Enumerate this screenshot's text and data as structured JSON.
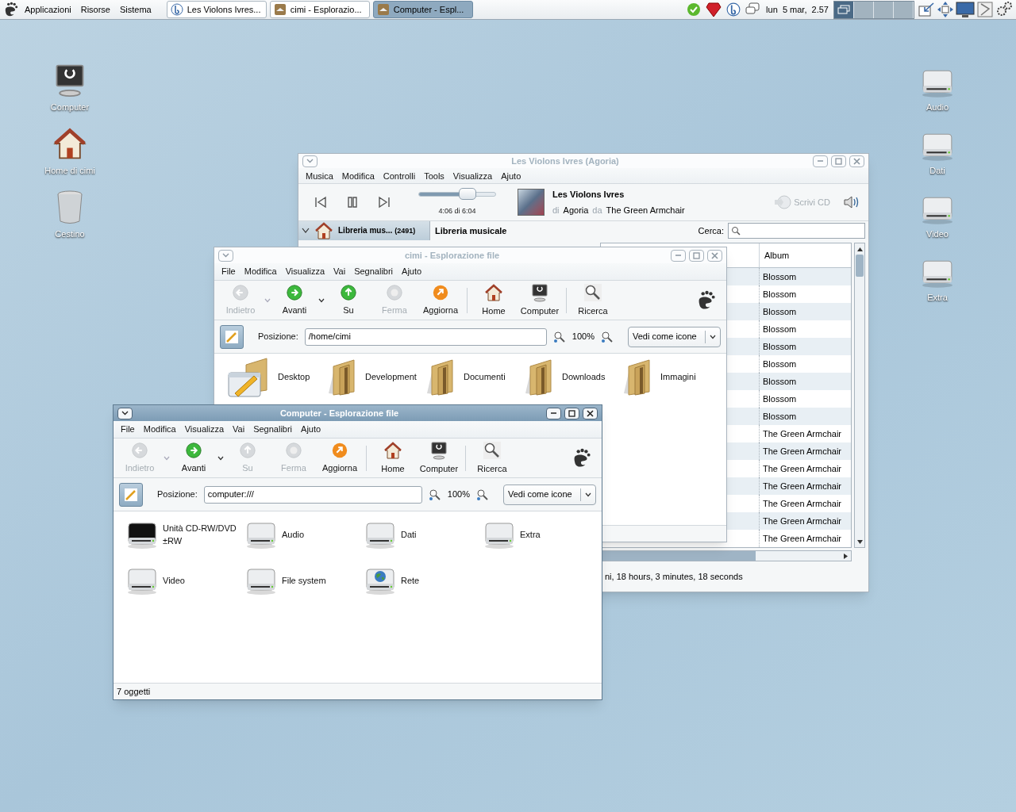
{
  "top_panel": {
    "menus": [
      "Applicazioni",
      "Risorse",
      "Sistema"
    ],
    "tasks": [
      {
        "label": "Les Violons Ivres...",
        "kind": "music",
        "selected": false
      },
      {
        "label": "cimi - Esplorazio...",
        "kind": "folder",
        "selected": false
      },
      {
        "label": "Computer - Espl...",
        "kind": "folder",
        "selected": true
      }
    ],
    "clock": "lun  5 mar,  2.57",
    "workspaces": [
      {
        "selected": true
      },
      {
        "selected": false
      },
      {
        "selected": false
      },
      {
        "selected": false
      }
    ]
  },
  "desktop_icons_left": [
    {
      "label": "Computer",
      "kind": "computer"
    },
    {
      "label": "Home di cimi",
      "kind": "home"
    },
    {
      "label": "Cestino",
      "kind": "trash"
    }
  ],
  "desktop_icons_right": [
    {
      "label": "Audio",
      "kind": "drive"
    },
    {
      "label": "Dati",
      "kind": "drive"
    },
    {
      "label": "Video",
      "kind": "drive"
    },
    {
      "label": "Extra",
      "kind": "drive"
    }
  ],
  "music_window": {
    "title": "Les Violons Ivres (Agoria)",
    "active": false,
    "menu": [
      "Musica",
      "Modifica",
      "Controlli",
      "Tools",
      "Visualizza",
      "Ajuto"
    ],
    "progress": {
      "level": 0.63
    },
    "time": "4:06 di 6:04",
    "track": {
      "title": "Les Violons Ivres",
      "by_label": "di",
      "artist": "Agoria",
      "from_label": "da",
      "album": "The Green Armchair"
    },
    "burn_label": "Scrivi CD",
    "library": {
      "label": "Libreria mus...",
      "count": "(2491)",
      "expanded": true
    },
    "heading": "Libreria musicale",
    "search_label": "Cerca:",
    "column": "Album",
    "rows": [
      "Blossom",
      "Blossom",
      "Blossom",
      "Blossom",
      "Blossom",
      "Blossom",
      "Blossom",
      "Blossom",
      "Blossom",
      "The Green Armchair",
      "The Green Armchair",
      "The Green Armchair",
      "The Green Armchair",
      "The Green Armchair",
      "The Green Armchair",
      "The Green Armchair"
    ],
    "status": "ni, 18 hours, 3 minutes, 18 seconds"
  },
  "file_windows": [
    {
      "title": "cimi - Esplorazione file",
      "active": false,
      "menu": [
        "File",
        "Modifica",
        "Visualizza",
        "Vai",
        "Segnalibri",
        "Ajuto"
      ],
      "toolbar": [
        {
          "label": "Indietro",
          "kind": "back",
          "disabled": true,
          "has_menu": true
        },
        {
          "label": "Avanti",
          "kind": "forward",
          "disabled": false,
          "has_menu": true
        },
        {
          "label": "Su",
          "kind": "up",
          "disabled": false,
          "has_menu": false
        },
        {
          "label": "Ferma",
          "kind": "stop",
          "disabled": true,
          "has_menu": false
        },
        {
          "label": "Aggiorna",
          "kind": "reload",
          "disabled": false,
          "has_menu": false
        },
        {
          "label": "Home",
          "kind": "home",
          "disabled": false,
          "has_menu": false
        },
        {
          "label": "Computer",
          "kind": "computer",
          "disabled": false,
          "has_menu": false
        },
        {
          "label": "Ricerca",
          "kind": "search",
          "disabled": false,
          "has_menu": false
        }
      ],
      "location_label": "Posizione:",
      "location": "/home/cimi",
      "zoom": "100%",
      "view": "Vedi come icone",
      "items": [
        {
          "label": "Desktop",
          "kind": "desktop-folder"
        },
        {
          "label": "Development",
          "kind": "folder"
        },
        {
          "label": "Documenti",
          "kind": "folder"
        },
        {
          "label": "Downloads",
          "kind": "folder"
        },
        {
          "label": "Immagini",
          "kind": "folder"
        }
      ]
    },
    {
      "title": "Computer - Esplorazione file",
      "active": true,
      "menu": [
        "File",
        "Modifica",
        "Visualizza",
        "Vai",
        "Segnalibri",
        "Ajuto"
      ],
      "toolbar": [
        {
          "label": "Indietro",
          "kind": "back",
          "disabled": true,
          "has_menu": true
        },
        {
          "label": "Avanti",
          "kind": "forward",
          "disabled": false,
          "has_menu": true
        },
        {
          "label": "Su",
          "kind": "up",
          "disabled": true,
          "has_menu": false
        },
        {
          "label": "Ferma",
          "kind": "stop",
          "disabled": true,
          "has_menu": false
        },
        {
          "label": "Aggiorna",
          "kind": "reload",
          "disabled": false,
          "has_menu": false
        },
        {
          "label": "Home",
          "kind": "home",
          "disabled": false,
          "has_menu": false
        },
        {
          "label": "Computer",
          "kind": "computer",
          "disabled": false,
          "has_menu": false
        },
        {
          "label": "Ricerca",
          "kind": "search",
          "disabled": false,
          "has_menu": false
        }
      ],
      "location_label": "Posizione:",
      "location": "computer:///",
      "zoom": "100%",
      "view": "Vedi come icone",
      "items": [
        {
          "label": "Unità CD-RW/DVD ±RW",
          "kind": "optical"
        },
        {
          "label": "Audio",
          "kind": "drive"
        },
        {
          "label": "Dati",
          "kind": "drive"
        },
        {
          "label": "Extra",
          "kind": "drive"
        },
        {
          "label": "Video",
          "kind": "drive"
        },
        {
          "label": "File system",
          "kind": "drive"
        },
        {
          "label": "Rete",
          "kind": "network"
        }
      ],
      "status": "7 oggetti"
    }
  ]
}
